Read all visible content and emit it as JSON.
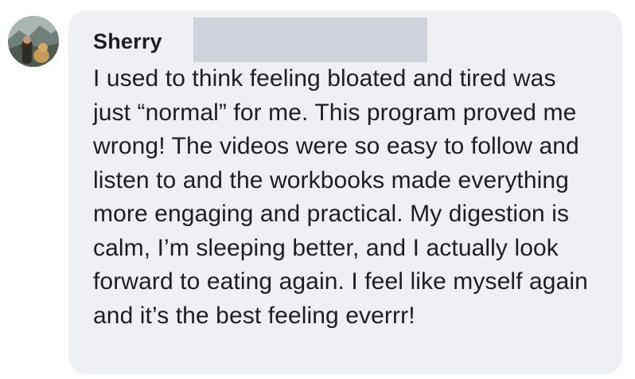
{
  "comment": {
    "author_name": "Sherry",
    "text": "I used to think feeling bloated and tired was just “normal” for me. This program proved me wrong! The videos were so easy to follow and listen to and the workbooks made everything more engaging and practical. My digestion is calm, I’m sleeping better, and I actually look forward to eating again. I feel like myself again and it’s the best feeling everrr!"
  },
  "colors": {
    "bubble_background": "#eef0f3",
    "text": "#1c1e21",
    "redaction": "#cfd4dc"
  }
}
